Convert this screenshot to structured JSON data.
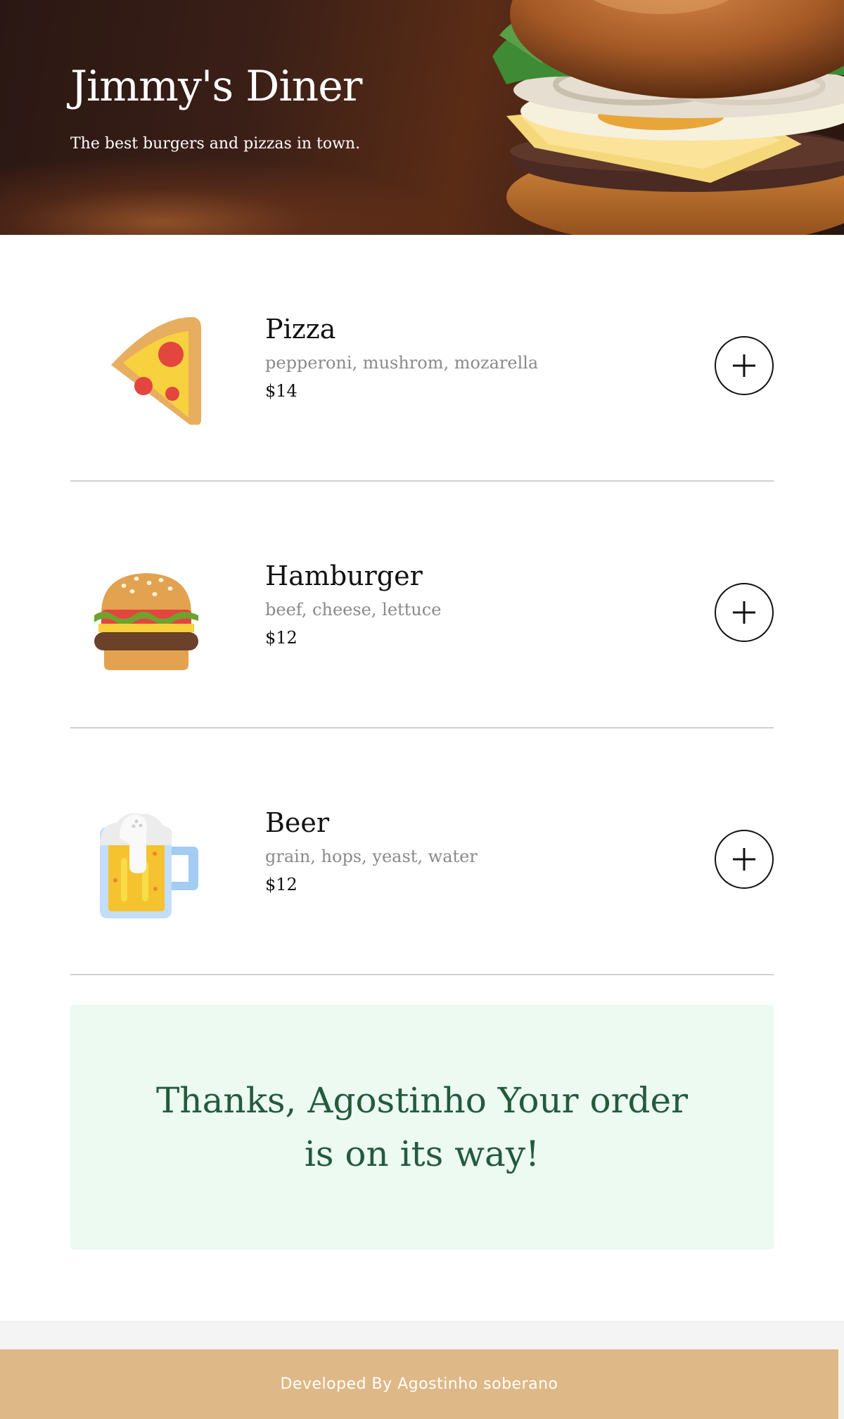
{
  "header": {
    "title": "Jimmy's Diner",
    "subtitle": "The best burgers and pizzas in town."
  },
  "menu": {
    "items": [
      {
        "icon": "pizza-slice-icon",
        "name": "Pizza",
        "ingredients": "pepperoni, mushrom, mozarella",
        "price": "$14"
      },
      {
        "icon": "hamburger-icon",
        "name": "Hamburger",
        "ingredients": "beef, cheese, lettuce",
        "price": "$12"
      },
      {
        "icon": "beer-mug-icon",
        "name": "Beer",
        "ingredients": "grain, hops, yeast, water",
        "price": "$12"
      }
    ]
  },
  "order_confirmation": {
    "message": "Thanks, Agostinho Your order is on its way!"
  },
  "footer": {
    "credit": "Developed By Agostinho soberano"
  },
  "colors": {
    "footer_bg": "#deb887",
    "thanks_bg": "#ecfaf1",
    "thanks_text": "#235a3e",
    "ingredients_text": "#8a8a8a"
  }
}
